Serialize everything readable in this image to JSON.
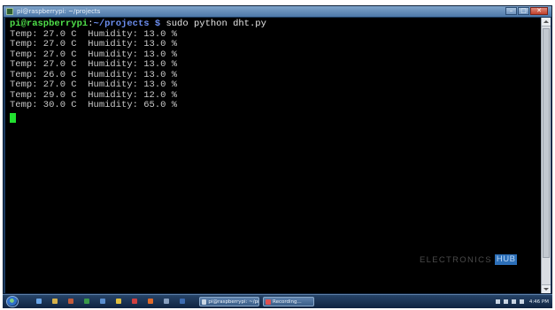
{
  "window": {
    "title": "pi@raspberrypi: ~/projects"
  },
  "terminal": {
    "prompt": {
      "user_host": "pi@raspberrypi",
      "colon": ":",
      "path": "~/projects",
      "dollar": " $",
      "command": " sudo python dht.py"
    },
    "lines": [
      "Temp: 27.0 C  Humidity: 13.0 %",
      "Temp: 27.0 C  Humidity: 13.0 %",
      "Temp: 27.0 C  Humidity: 13.0 %",
      "Temp: 27.0 C  Humidity: 13.0 %",
      "Temp: 26.0 C  Humidity: 13.0 %",
      "Temp: 27.0 C  Humidity: 13.0 %",
      "Temp: 29.0 C  Humidity: 12.0 %",
      "Temp: 30.0 C  Humidity: 65.0 %"
    ],
    "cursor_color": "#22e030"
  },
  "watermark": {
    "text": "ELECTRONICS",
    "box": "HUB"
  },
  "taskbar": {
    "buttons": [
      {
        "label": "pi@raspberrypi: ~/pr...",
        "icon": "terminal-icon"
      },
      {
        "label": "Recording...",
        "icon": "record-icon"
      }
    ],
    "clock": "4:46 PM"
  },
  "colors": {
    "terminal_bg": "#000000",
    "prompt_user": "#4fe04a",
    "prompt_path": "#6c8ef0",
    "output_text": "#c8c8c8",
    "taskbar": "#1a3356"
  }
}
